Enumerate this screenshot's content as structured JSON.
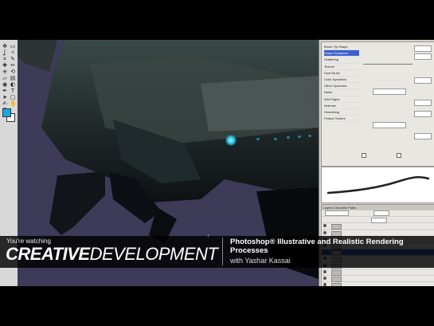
{
  "overlay": {
    "watching_label": "You're watching",
    "brand_part1": "CREATIVE",
    "brand_part2": "DEVELOPMENT",
    "course_title": "Photoshop® Illustrative and Realistic Rendering Processes",
    "course_author": "with Yashar Kassai"
  },
  "colors": {
    "foreground": "#1aa7d9",
    "background": "#ffffff",
    "selection": "#3a5fcd",
    "glow": "#2bbde0"
  },
  "toolbox": {
    "icons": [
      "move-icon",
      "marquee-icon",
      "lasso-icon",
      "magic-wand-icon",
      "crop-icon",
      "eyedropper-icon",
      "heal-icon",
      "brush-icon",
      "stamp-icon",
      "history-brush-icon",
      "eraser-icon",
      "gradient-icon",
      "blur-icon",
      "dodge-icon",
      "pen-icon",
      "type-icon",
      "path-select-icon",
      "shape-icon",
      "notes-icon",
      "hand-icon",
      "zoom-icon"
    ]
  },
  "brush_panel": {
    "rows": [
      "Brush Tip Shape",
      "Shape Dynamics",
      "Scattering",
      "Texture",
      "Dual Brush",
      "Color Dynamics",
      "Other Dynamics",
      "Noise",
      "Wet Edges",
      "Airbrush",
      "Smoothing",
      "Protect Texture"
    ],
    "selected_index": 1
  },
  "layers_panel": {
    "tabs": "Layers  Channels  Paths",
    "rows": [
      "",
      "",
      "",
      "",
      "",
      "",
      "",
      "",
      "",
      "",
      "",
      "",
      ""
    ],
    "selected_index": 4
  }
}
